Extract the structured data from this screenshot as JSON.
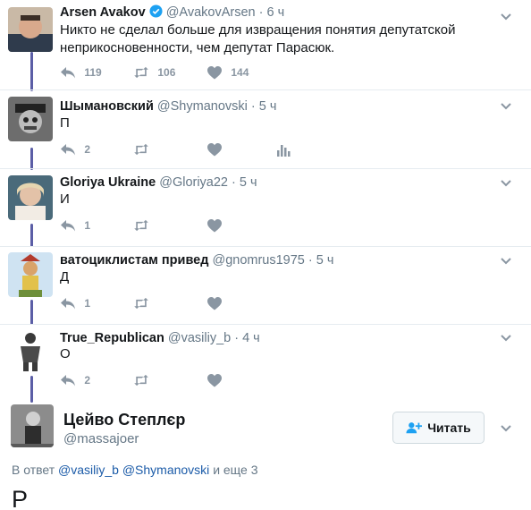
{
  "tweets": [
    {
      "name": "Arsen Avakov",
      "verified": true,
      "handle": "@AvakovArsen",
      "time": "6 ч",
      "text_line1": "Никто не сделал больше  для извращения понятия депутатской",
      "text_line2": "неприкосновенности, чем депутат Парасюк.",
      "reply_count": "119",
      "retweet_count": "106",
      "like_count": "144"
    },
    {
      "name": "Шымановский",
      "handle": "@Shymanovski",
      "time": "5 ч",
      "text": "П",
      "reply_count": "2"
    },
    {
      "name": "Gloriya Ukraine",
      "handle": "@Gloriya22",
      "time": "5 ч",
      "text": "И",
      "reply_count": "1"
    },
    {
      "name": "ватоциклистам привед",
      "handle": "@gnomrus1975",
      "time": "5 ч",
      "text": "Д",
      "reply_count": "1"
    },
    {
      "name": "True_Republican",
      "handle": "@vasiliy_b",
      "time": "4 ч",
      "text": "О",
      "reply_count": "2"
    }
  ],
  "main_tweet": {
    "name": "Цейво Степлєр",
    "handle": "@massajoer",
    "follow_label": "Читать",
    "reply_prefix": "В ответ",
    "mention1": "@vasiliy_b",
    "mention2": "@Shymanovski",
    "reply_suffix": "и еще 3",
    "text": "Р"
  },
  "colors": {
    "thread_line": "#5b5ea6",
    "verified": "#1da1f2",
    "action_icon": "#8a96a2",
    "mention": "#1b5ba8"
  },
  "icons": [
    "reply-icon",
    "retweet-icon",
    "like-icon",
    "analytics-icon",
    "chevron-down-icon",
    "verified-badge-icon",
    "follow-icon"
  ]
}
